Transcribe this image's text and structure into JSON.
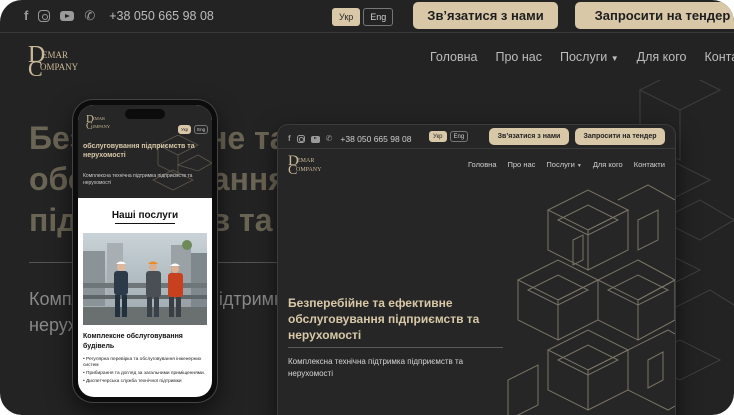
{
  "site": {
    "phone": "+38 050 665 98 08",
    "lang": [
      "Укр",
      "Eng"
    ],
    "cta_contact": "Зв’язатися з нами",
    "cta_tender": "Запросити на тендер",
    "logo": {
      "letter1": "D",
      "text1": "EMAR",
      "letter2": "C",
      "text2": "OMPANY"
    },
    "nav": [
      "Головна",
      "Про нас",
      "Послуги",
      "Для кого",
      "Контакти"
    ],
    "hero_title": "Безперебійне та ефективне обслуговування підприємств та нерухомості",
    "hero_subtitle": "Комплексна технічна підтримка підприємств та нерухомості",
    "bg_hero_lines": [
      "Безперебійне та ефективне",
      "обслуговування",
      "підприємств та"
    ],
    "bg_sub_lines": [
      "Комплексна технічна підтримка",
      "нерухомості"
    ]
  },
  "phone_view": {
    "hero_title": "обслуговування підприємств та нерухомості",
    "hero_subtitle": "Комплексна технічна підтримка підприємств та нерухомості",
    "services_title": "Наші послуги",
    "card_title": "Комплексне обслуговування будівель",
    "card_items": [
      "• Регулярна перевірка та обслуговування інженерних систем",
      "• Прибирання та догляд за загальними приміщеннями.",
      "• Диспетчерська служба технічної підтримки"
    ]
  },
  "colors": {
    "accent": "#d8c8a8",
    "background": "#262626"
  },
  "icons": [
    "facebook-icon",
    "instagram-icon",
    "youtube-icon",
    "phone-icon",
    "chevron-down-icon"
  ]
}
